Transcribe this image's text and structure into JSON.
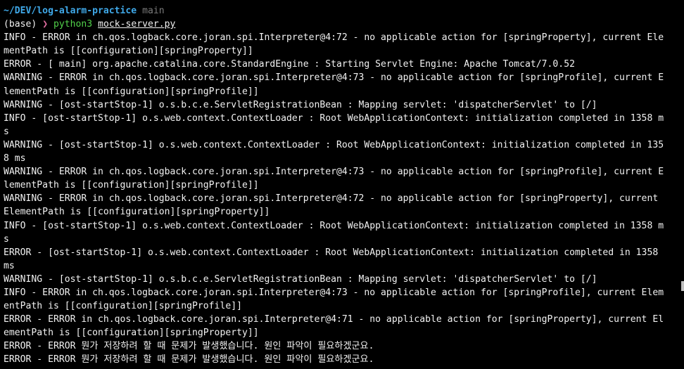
{
  "prompt": {
    "cwd": "~/DEV/log-alarm-practice",
    "branch": "main",
    "env": "(base)",
    "arrow": "❯",
    "command": "python3",
    "argument": "mock-server.py"
  },
  "lines": [
    "INFO - ERROR in ch.qos.logback.core.joran.spi.Interpreter@4:72 - no applicable action for [springProperty], current Ele",
    "mentPath is [[configuration][springProperty]]",
    "ERROR - [ main] org.apache.catalina.core.StandardEngine : Starting Servlet Engine: Apache Tomcat/7.0.52",
    "WARNING - ERROR in ch.qos.logback.core.joran.spi.Interpreter@4:73 - no applicable action for [springProfile], current E",
    "lementPath is [[configuration][springProfile]]",
    "WARNING - [ost-startStop-1] o.s.b.c.e.ServletRegistrationBean : Mapping servlet: 'dispatcherServlet' to [/]",
    "INFO - [ost-startStop-1] o.s.web.context.ContextLoader : Root WebApplicationContext: initialization completed in 1358 m",
    "s",
    "WARNING - [ost-startStop-1] o.s.web.context.ContextLoader : Root WebApplicationContext: initialization completed in 135",
    "8 ms",
    "WARNING - ERROR in ch.qos.logback.core.joran.spi.Interpreter@4:73 - no applicable action for [springProfile], current E",
    "lementPath is [[configuration][springProfile]]",
    "WARNING - ERROR in ch.qos.logback.core.joran.spi.Interpreter@4:72 - no applicable action for [springProperty], current",
    "ElementPath is [[configuration][springProperty]]",
    "INFO - [ost-startStop-1] o.s.web.context.ContextLoader : Root WebApplicationContext: initialization completed in 1358 m",
    "s",
    "ERROR - [ost-startStop-1] o.s.web.context.ContextLoader : Root WebApplicationContext: initialization completed in 1358",
    "ms",
    "WARNING - [ost-startStop-1] o.s.b.c.e.ServletRegistrationBean : Mapping servlet: 'dispatcherServlet' to [/]",
    "INFO - ERROR in ch.qos.logback.core.joran.spi.Interpreter@4:73 - no applicable action for [springProfile], current Elem",
    "entPath is [[configuration][springProfile]]",
    "ERROR - ERROR in ch.qos.logback.core.joran.spi.Interpreter@4:71 - no applicable action for [springProperty], current El",
    "ementPath is [[configuration][springProperty]]",
    "ERROR - ERROR 뭔가 저장하려 할 때 문제가 발생했습니다. 원인 파악이 필요하겠군요.",
    "ERROR - ERROR 뭔가 저장하려 할 때 문제가 발생했습니다. 원인 파악이 필요하겠군요."
  ]
}
